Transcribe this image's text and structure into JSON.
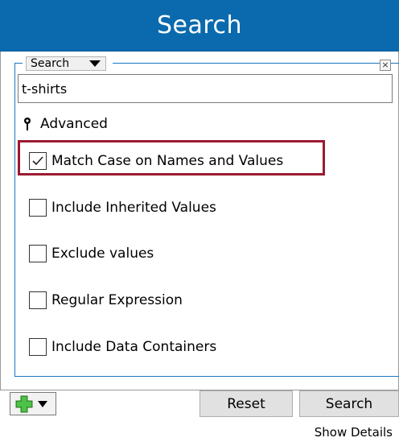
{
  "window": {
    "title": "Search"
  },
  "search_group": {
    "scope_dropdown": "Search",
    "close_label": "×",
    "query": "t-shirts",
    "advanced_label": "Advanced"
  },
  "options": [
    {
      "label": "Match Case on Names and Values",
      "checked": true,
      "highlighted": true
    },
    {
      "label": "Include Inherited Values",
      "checked": false
    },
    {
      "label": "Exclude values",
      "checked": false
    },
    {
      "label": "Regular Expression",
      "checked": false
    },
    {
      "label": "Include Data Containers",
      "checked": false
    }
  ],
  "footer": {
    "add_icon": "green-plus-icon",
    "reset_label": "Reset",
    "search_label": "Search",
    "show_details_label": "Show Details"
  },
  "colors": {
    "title_bar": "#0b6aae",
    "highlight_border": "#9b1b30",
    "group_border": "#1a78c2",
    "add_icon_green": "#3aa935"
  }
}
